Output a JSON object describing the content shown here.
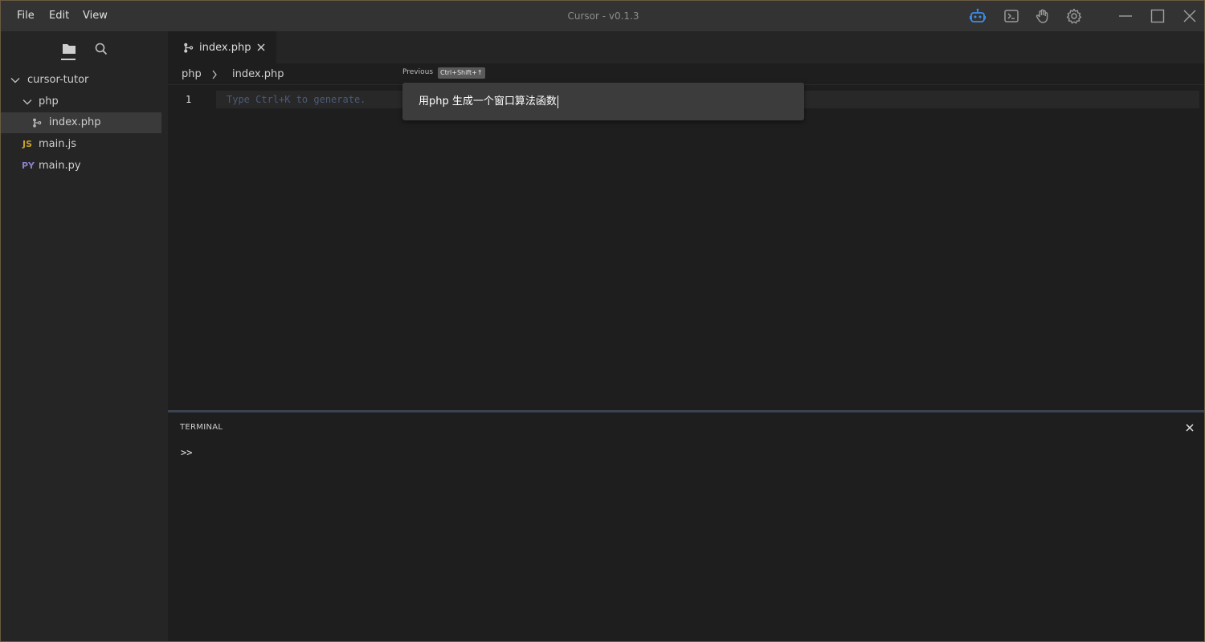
{
  "titlebar": {
    "title": "Cursor - v0.1.3",
    "menu": [
      "File",
      "Edit",
      "View"
    ],
    "icons": [
      "robot-icon",
      "terminal-icon",
      "hand-icon",
      "gear-icon"
    ],
    "window_controls": [
      "minimize-icon",
      "maximize-icon",
      "close-icon"
    ]
  },
  "sidebar": {
    "tabs": [
      "folder-icon",
      "search-icon"
    ],
    "tree": [
      {
        "label": "cursor-tutor",
        "type": "folder",
        "expanded": true
      },
      {
        "label": "php",
        "type": "folder",
        "expanded": true
      },
      {
        "label": "index.php",
        "type": "file",
        "icon": "php-file-icon",
        "selected": true
      },
      {
        "label": "main.js",
        "type": "file",
        "badge": "JS"
      },
      {
        "label": "main.py",
        "type": "file",
        "badge": "PY"
      }
    ]
  },
  "editor": {
    "tab": {
      "label": "index.php"
    },
    "breadcrumb": [
      "php",
      "index.php"
    ],
    "line_number": "1",
    "placeholder": "Type Ctrl+K to generate.",
    "previous_label": "Previous",
    "previous_shortcut": "Ctrl+Shift+↑",
    "prompt_value": "用php 生成一个窗口算法函数"
  },
  "terminal": {
    "title": "TERMINAL",
    "prompt": ">>"
  },
  "colors": {
    "accent_blue": "#3b8eea",
    "js_badge": "#c9a227",
    "py_badge": "#8b7fc9",
    "window_border": "#6b5a3f"
  }
}
